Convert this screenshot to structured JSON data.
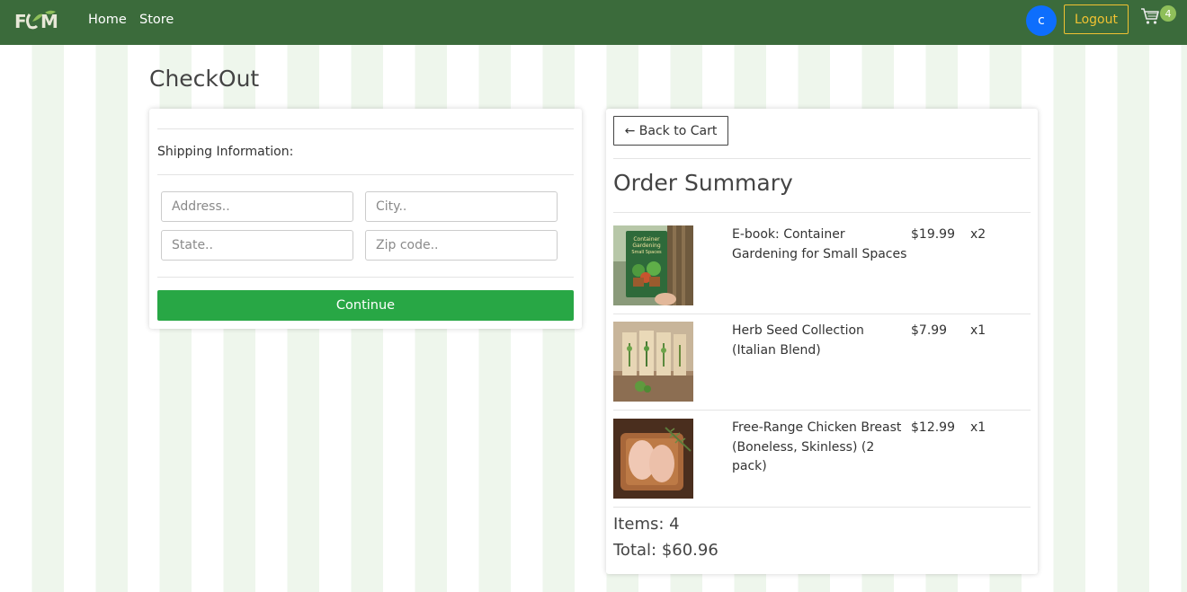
{
  "navbar": {
    "logo_text": "FCM",
    "links": [
      "Home",
      "Store"
    ],
    "avatar_initial": "c",
    "logout_label": "Logout",
    "cart_count": "4"
  },
  "page": {
    "title": "CheckOut"
  },
  "shipping": {
    "label": "Shipping Information:",
    "address_placeholder": "Address..",
    "city_placeholder": "City..",
    "state_placeholder": "State..",
    "zip_placeholder": "Zip code..",
    "continue_label": "Continue"
  },
  "summary": {
    "back_label": "← Back to Cart",
    "title": "Order Summary",
    "items": [
      {
        "name": "E-book: Container Gardening for Small Spaces",
        "price": "$19.99",
        "qty": "x2",
        "image": "ebook-cover"
      },
      {
        "name": "Herb Seed Collection (Italian Blend)",
        "price": "$7.99",
        "qty": "x1",
        "image": "herb-seed-packets"
      },
      {
        "name": "Free-Range Chicken Breast (Boneless, Skinless) (2 pack)",
        "price": "$12.99",
        "qty": "x1",
        "image": "chicken-breast-tray"
      }
    ],
    "items_count": "Items: 4",
    "total": "Total: $60.96"
  },
  "colors": {
    "navbar": "#3b6b3b",
    "continue": "#28a745",
    "logout": "#f1c232",
    "avatar": "#0d6efd"
  }
}
